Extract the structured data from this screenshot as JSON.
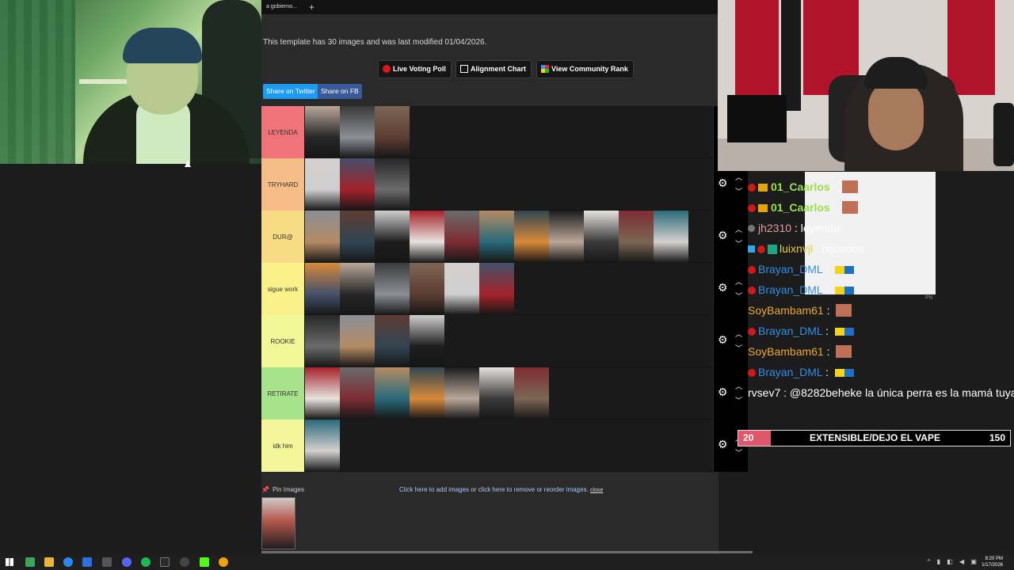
{
  "browser": {
    "tab_title": "a gobierno...",
    "new_tab_symbol": "+"
  },
  "page": {
    "meta_text": "This template has 30 images and was last modified 01/04/2026.",
    "buttons": {
      "live_voting": "Live Voting Poll",
      "alignment_chart": "Alignment Chart",
      "community_rank": "View Community Rank"
    },
    "share": {
      "twitter": "Share on Twitter",
      "facebook": "Share on FB"
    }
  },
  "tiers": [
    {
      "label": "LEYENDA",
      "color": "#ef7378",
      "images": 3
    },
    {
      "label": "TRYHARD",
      "color": "#f6bd88",
      "images": 3
    },
    {
      "label": "DUR@",
      "color": "#f8dc85",
      "images": 11
    },
    {
      "label": "sigue work",
      "color": "#fbf18b",
      "images": 6
    },
    {
      "label": "ROOKIE",
      "color": "#f2f797",
      "images": 4
    },
    {
      "label": "RETIRATE",
      "color": "#a8e28a",
      "images": 7
    },
    {
      "label": "idk him",
      "color": "#f4f69a",
      "images": 1
    }
  ],
  "pin": {
    "label": "Pin Images",
    "add_images": "Click here to add images",
    "or": "or",
    "remove_images": "click here to remove or reorder images.",
    "close": "close"
  },
  "chat": {
    "overlay_tag": "PN",
    "messages": [
      {
        "user": "01_Caarlos",
        "sep": ":",
        "text": ""
      },
      {
        "user": "01_Caarlos",
        "sep": ":",
        "text": ""
      },
      {
        "user": "jh2310",
        "sep": ":",
        "text": "leyenda"
      },
      {
        "user": "luixnvjl",
        "sep": ":",
        "text": "hijooooo"
      },
      {
        "user": "Brayan_DML",
        "sep": ":",
        "text": ""
      },
      {
        "user": "Brayan_DML",
        "sep": ":",
        "text": ""
      },
      {
        "user": "SoyBambam61",
        "sep": ":",
        "text": ""
      },
      {
        "user": "Brayan_DML",
        "sep": ":",
        "text": ""
      },
      {
        "user": "SoyBambam61",
        "sep": ":",
        "text": ""
      },
      {
        "user": "Brayan_DML",
        "sep": ":",
        "text": ""
      },
      {
        "user": "rvsev7",
        "sep": ":",
        "text": "@8282beheke la única perra es la mamá tuya"
      }
    ]
  },
  "goal": {
    "start": "20",
    "title": "EXTENSIBLE/DEJO EL VAPE",
    "end": "150",
    "progress_fraction": 0.12
  },
  "taskbar": {
    "time": "8:20 PM",
    "date": "1/17/2026"
  },
  "colors": {
    "accent_red": "#e0141b",
    "twitter": "#1d9bf0",
    "facebook": "#3b5998",
    "goal_fill": "#e0576b"
  }
}
